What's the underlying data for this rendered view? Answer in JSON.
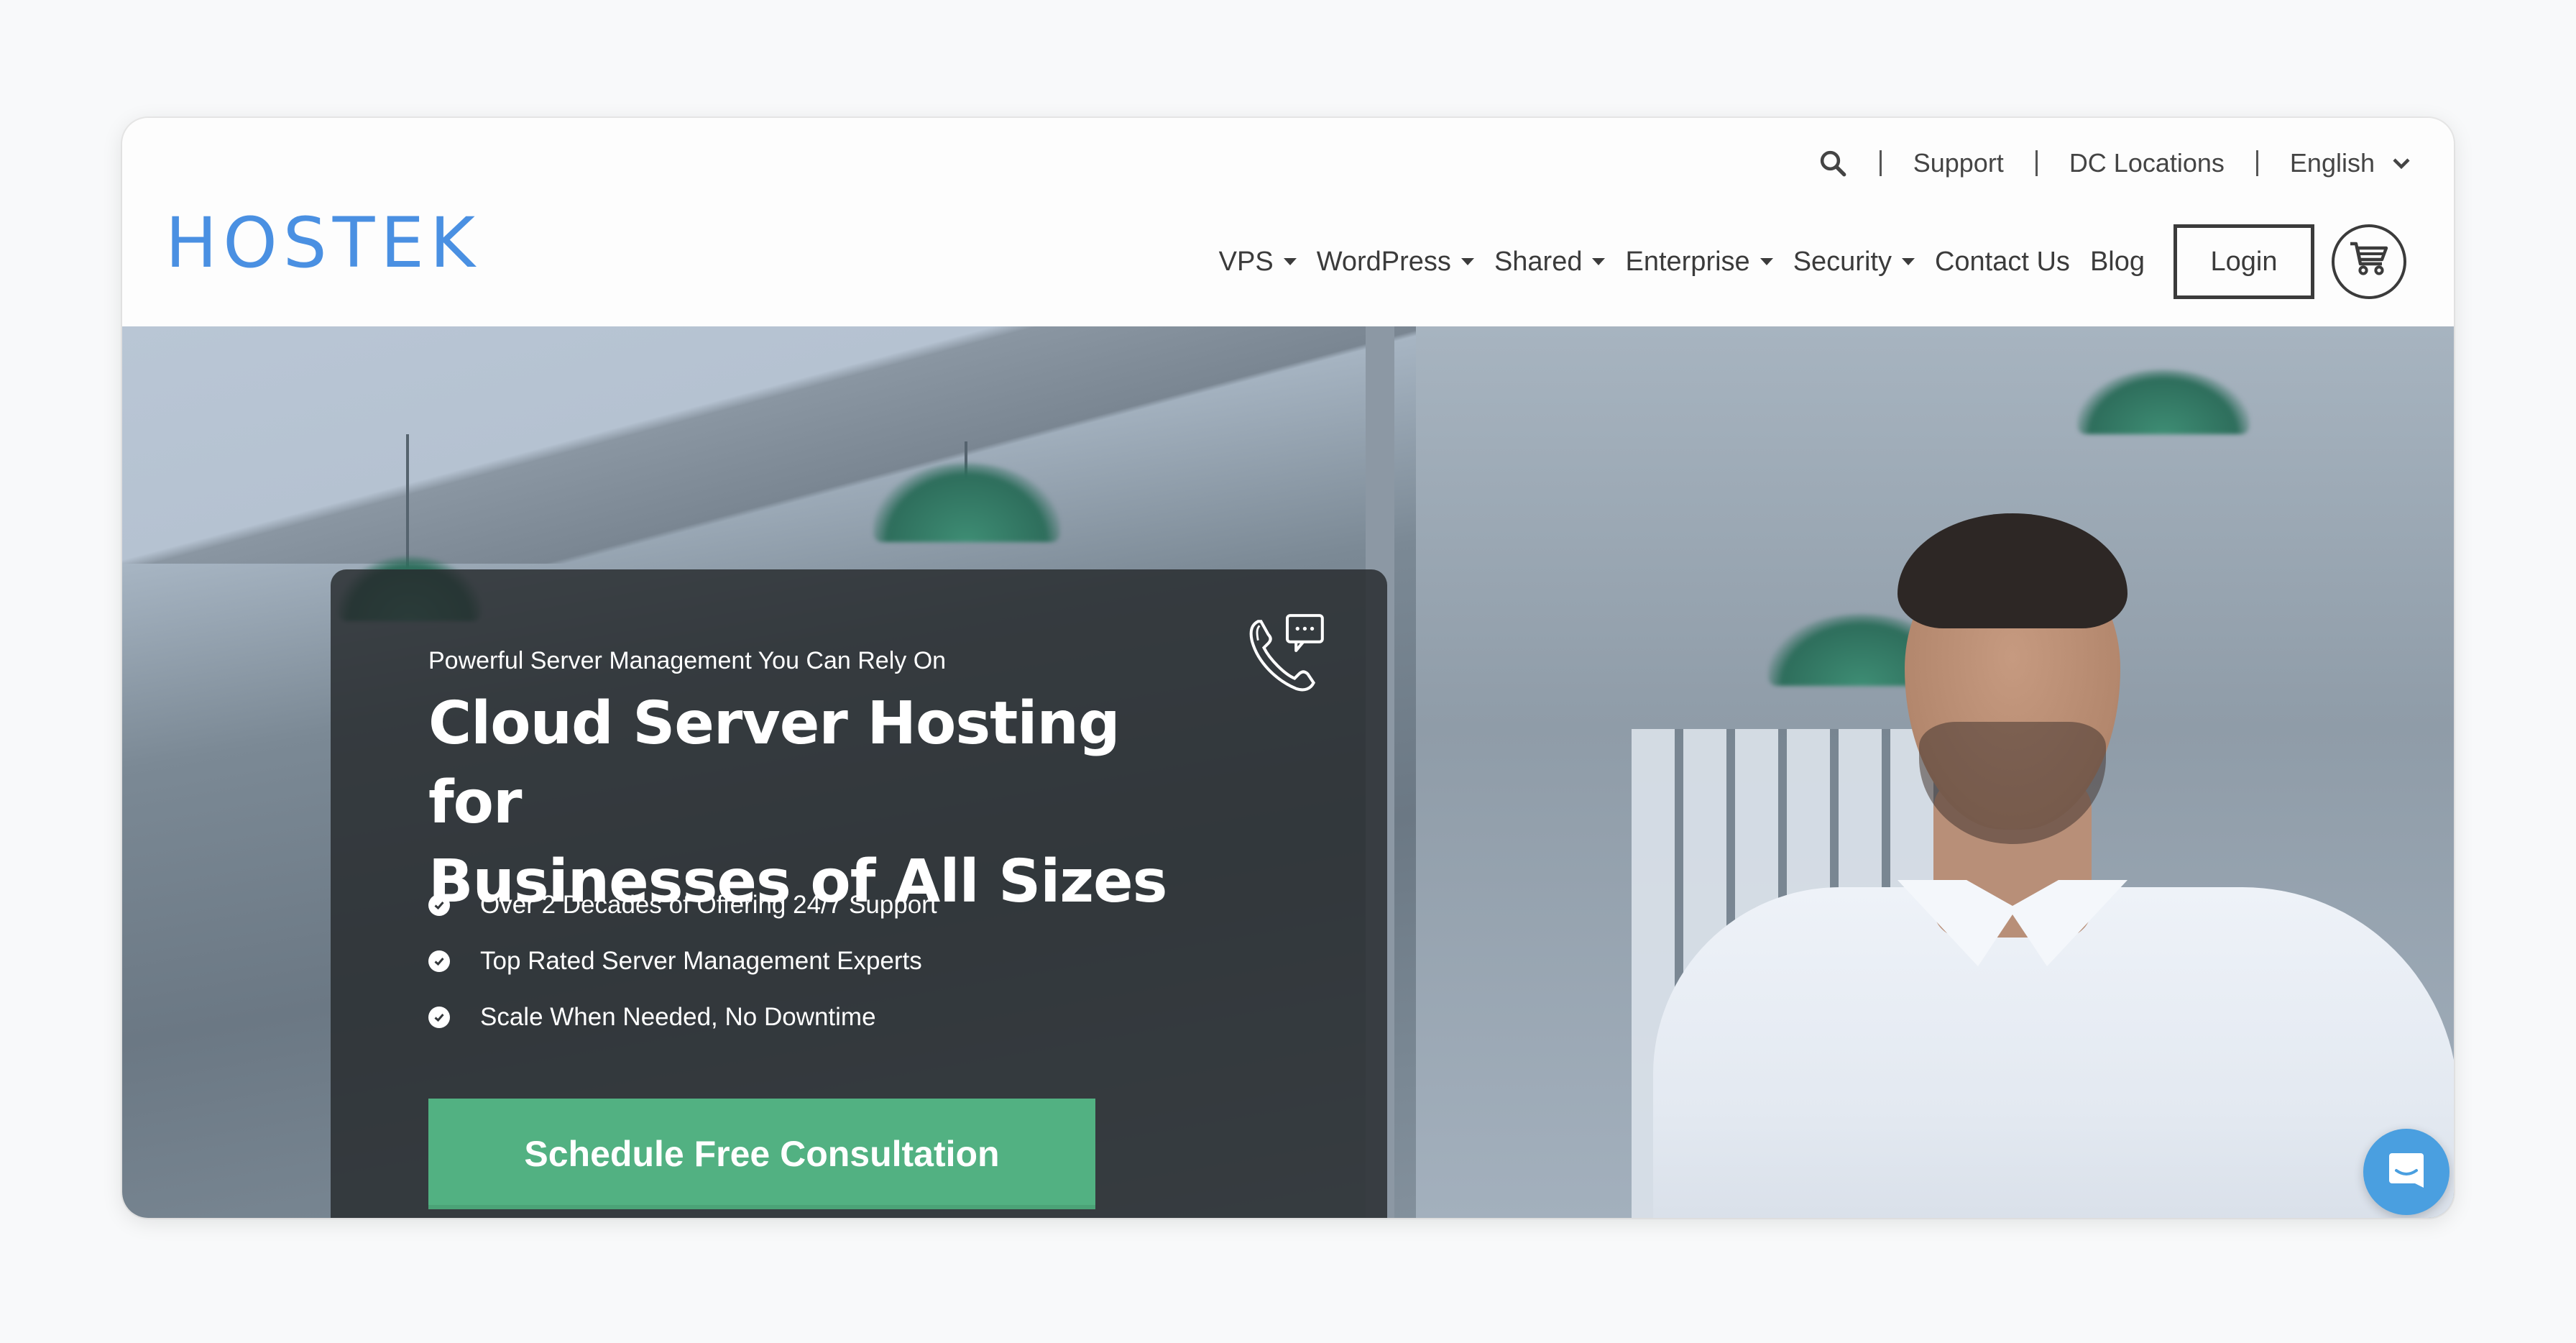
{
  "brand": {
    "logo_text": "HOSTEK",
    "logo_color": "#4a90e2"
  },
  "utility_bar": {
    "search_icon": "search-icon",
    "links": [
      {
        "label": "Support"
      },
      {
        "label": "DC Locations"
      }
    ],
    "language": {
      "selected": "English",
      "icon": "chevron-down-icon"
    }
  },
  "nav": {
    "items": [
      {
        "label": "VPS",
        "has_dropdown": true
      },
      {
        "label": "WordPress",
        "has_dropdown": true
      },
      {
        "label": "Shared",
        "has_dropdown": true
      },
      {
        "label": "Enterprise",
        "has_dropdown": true
      },
      {
        "label": "Security",
        "has_dropdown": true
      },
      {
        "label": "Contact Us",
        "has_dropdown": false
      },
      {
        "label": "Blog",
        "has_dropdown": false
      }
    ],
    "login_label": "Login",
    "cart_icon": "shopping-cart-icon"
  },
  "hero": {
    "eyebrow": "Powerful Server Management You Can Rely On",
    "title_line1": "Cloud Server Hosting for",
    "title_line2": "Businesses of All Sizes",
    "features": [
      {
        "text": "Over 2 Decades of Offering 24/7 Support"
      },
      {
        "text": "Top Rated Server Management Experts"
      },
      {
        "text": "Scale When Needed, No Downtime"
      }
    ],
    "cta_label": "Schedule Free Consultation",
    "cta_color": "#52b182",
    "support_icon": "phone-chat-icon"
  },
  "chat_widget": {
    "icon": "chat-bubble-icon",
    "color": "#4a9fe0"
  }
}
